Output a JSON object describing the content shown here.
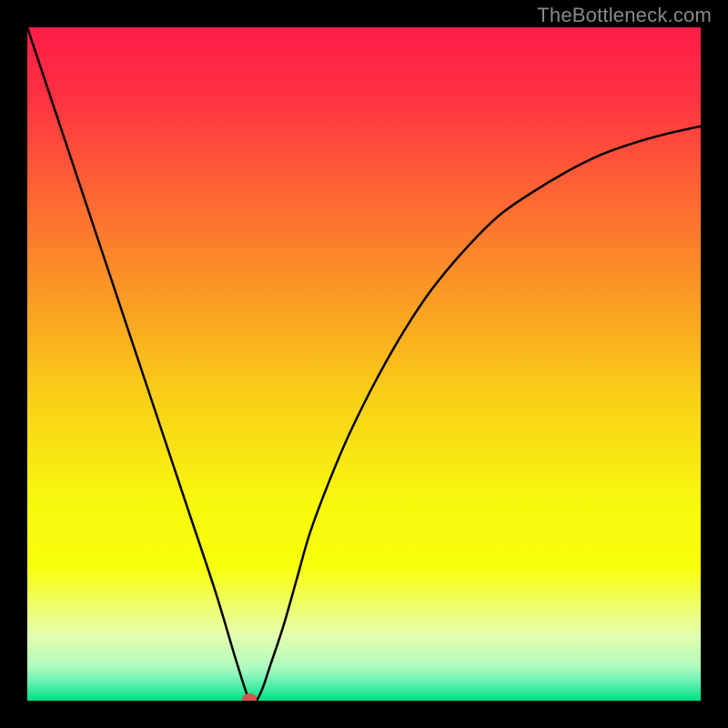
{
  "watermark": "TheBottleneck.com",
  "chart_data": {
    "type": "line",
    "title": "",
    "xlabel": "",
    "ylabel": "",
    "xlim": [
      0,
      100
    ],
    "ylim": [
      0,
      100
    ],
    "grid": false,
    "legend": false,
    "background_gradient": {
      "stops": [
        {
          "pos": 0.0,
          "color": "#ff1d49"
        },
        {
          "pos": 0.1,
          "color": "#ff3042"
        },
        {
          "pos": 0.25,
          "color": "#fd6633"
        },
        {
          "pos": 0.4,
          "color": "#fb9b24"
        },
        {
          "pos": 0.55,
          "color": "#f9cf17"
        },
        {
          "pos": 0.7,
          "color": "#f8f70e"
        },
        {
          "pos": 0.8,
          "color": "#f9ff0a"
        },
        {
          "pos": 0.9,
          "color": "#e6feac"
        },
        {
          "pos": 0.95,
          "color": "#b0fbc0"
        },
        {
          "pos": 0.97,
          "color": "#6cf2b4"
        },
        {
          "pos": 1.0,
          "color": "#00e183"
        }
      ]
    },
    "series": [
      {
        "name": "bottleneck-curve",
        "description": "V-shaped bottleneck curve; minimum at x≈33",
        "x": [
          0,
          4,
          8,
          12,
          16,
          20,
          24,
          28,
          31,
          33,
          34,
          35,
          36,
          38,
          40,
          42,
          45,
          48,
          52,
          56,
          60,
          65,
          70,
          75,
          80,
          85,
          90,
          95,
          100
        ],
        "y": [
          100,
          88,
          76,
          64,
          52,
          40,
          28,
          16,
          6,
          0,
          0,
          2,
          5,
          11,
          18,
          25,
          33,
          40,
          48,
          55,
          61,
          67,
          72,
          75.5,
          78.5,
          81,
          82.8,
          84.2,
          85.3
        ]
      }
    ],
    "marker": {
      "name": "optimal-point",
      "x": 33,
      "y": 0,
      "color": "#d9534f",
      "rx": 8,
      "ry": 6
    }
  }
}
